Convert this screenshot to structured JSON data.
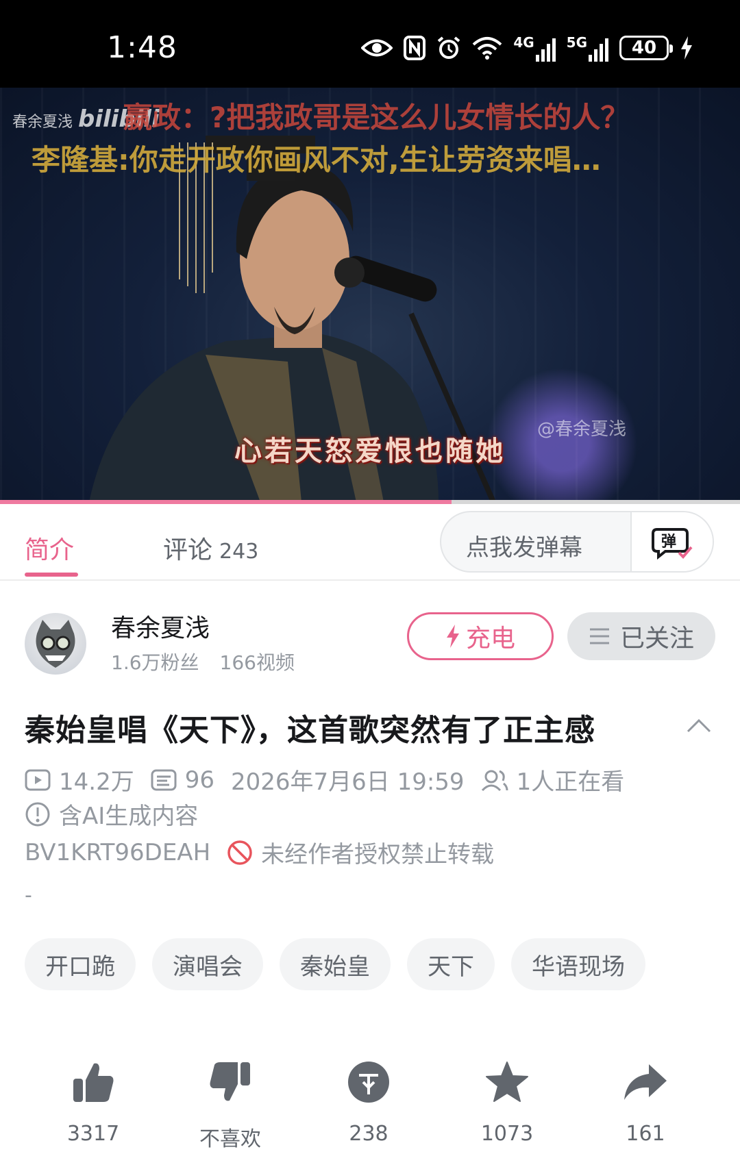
{
  "status_bar": {
    "time": "1:48",
    "signal_1": "4G",
    "signal_2": "5G",
    "battery": "40",
    "icons": [
      "eye-icon",
      "nfc-icon",
      "alarm-icon",
      "wifi-icon",
      "signal-4g-icon",
      "signal-5g-icon",
      "battery-icon",
      "charging-icon"
    ]
  },
  "video": {
    "watermark_top": "春余夏浅",
    "watermark_logo": "bilibili",
    "watermark_handle": "@春余夏浅",
    "danmaku": [
      "嬴政：?把我政哥是这么儿女情长的人？",
      "李隆基:你走开政你画风不对,生让劳资来唱…"
    ],
    "subtitle": "心若天怒爱恨也随她",
    "progress": 0.61,
    "accent_color": "#ef7aa0"
  },
  "tabs": {
    "intro_label": "简介",
    "comments_label": "评论",
    "comments_count": "243",
    "danmaku_placeholder": "点我发弹幕",
    "danmaku_button_glyph": "弹"
  },
  "uploader": {
    "name": "春余夏浅",
    "fans": "1.6万粉丝",
    "videos": "166视频",
    "charge_label": "充电",
    "follow_label": "已关注"
  },
  "detail": {
    "title": "秦始皇唱《天下》，这首歌突然有了正主感",
    "views": "14.2万",
    "danmaku_count": "96",
    "publish_time": "2026年7月6日 19:59",
    "watching": "1人正在看",
    "ai_notice": "含AI生成内容",
    "bvid": "BV1KRT96DEAH",
    "copyright_notice": "未经作者授权禁止转载",
    "description": "-"
  },
  "tags": [
    "开口跪",
    "演唱会",
    "秦始皇",
    "天下",
    "华语现场"
  ],
  "actions": {
    "like": "3317",
    "dislike": "不喜欢",
    "coin": "238",
    "favorite": "1073",
    "share": "161"
  },
  "colors": {
    "brand_pink": "#e8638c",
    "text_primary": "#18191c",
    "text_secondary": "#61666d",
    "text_tertiary": "#9499a0",
    "icon_dark": "#61666d"
  }
}
